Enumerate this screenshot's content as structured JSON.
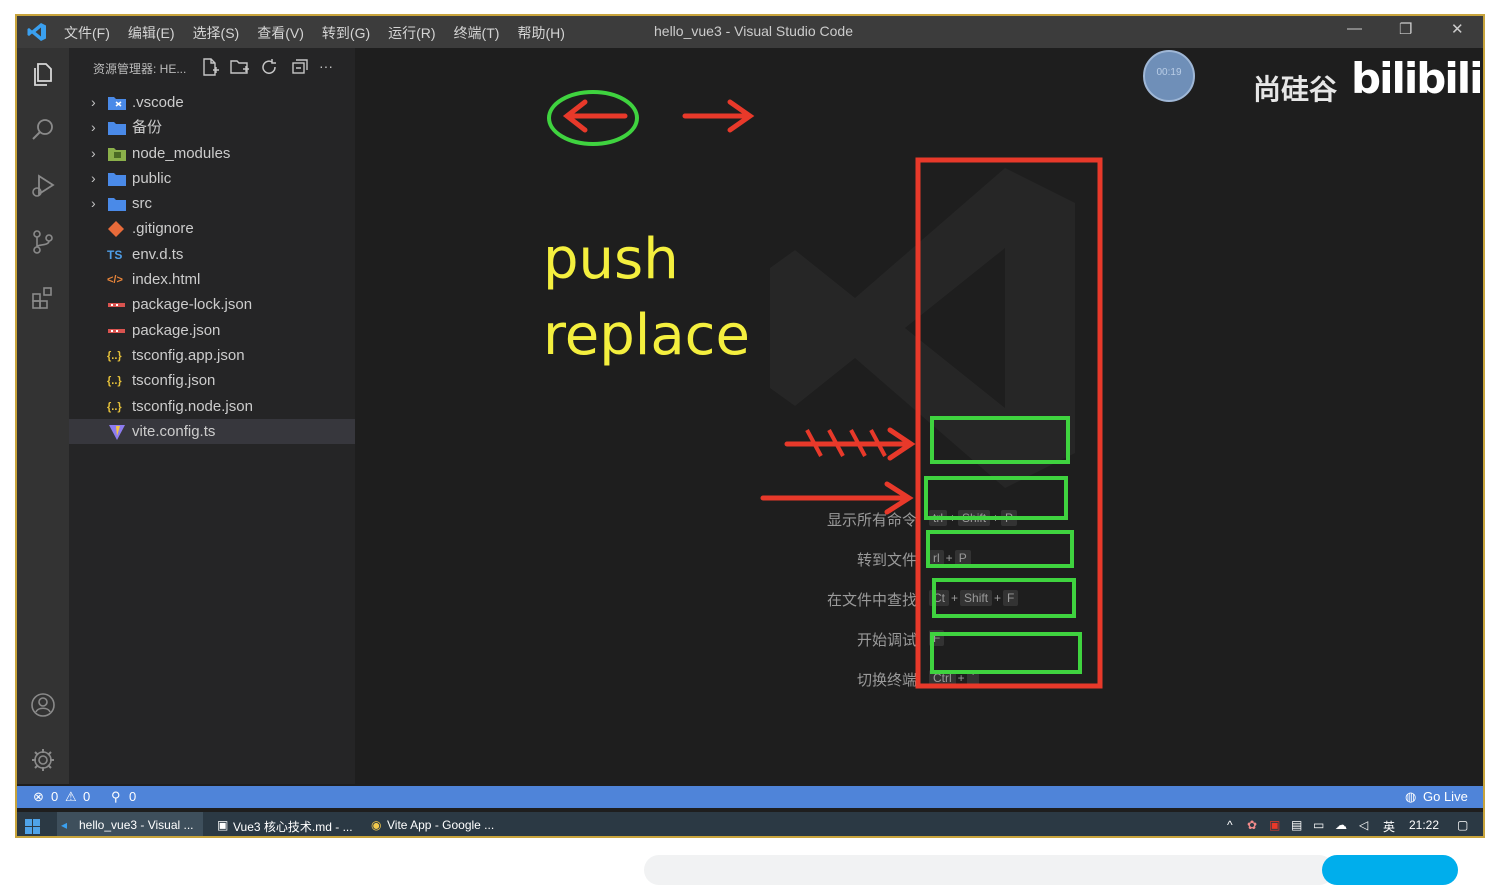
{
  "titlebar": {
    "menus": [
      "文件(F)",
      "编辑(E)",
      "选择(S)",
      "查看(V)",
      "转到(G)",
      "运行(R)",
      "终端(T)",
      "帮助(H)"
    ],
    "window_title": "hello_vue3 - Visual Studio Code",
    "minimize": "—",
    "restore": "❐",
    "close": "✕"
  },
  "overlay": {
    "timer": "00:19",
    "watermark_text": "尚硅谷",
    "watermark_logo": "bilibili"
  },
  "sidebar": {
    "header": "资源管理器: HE...",
    "more": "···",
    "items": [
      {
        "label": ".vscode",
        "type": "folder",
        "icon": "vscode-folder-icon"
      },
      {
        "label": "备份",
        "type": "folder",
        "icon": "folder-icon"
      },
      {
        "label": "node_modules",
        "type": "folder",
        "icon": "node-folder-icon"
      },
      {
        "label": "public",
        "type": "folder",
        "icon": "folder-icon"
      },
      {
        "label": "src",
        "type": "folder",
        "icon": "folder-icon"
      },
      {
        "label": ".gitignore",
        "type": "file",
        "icon": "git-icon"
      },
      {
        "label": "env.d.ts",
        "type": "file",
        "icon": "ts-icon",
        "icon_text": "TS"
      },
      {
        "label": "index.html",
        "type": "file",
        "icon": "html-icon",
        "icon_text": "</>"
      },
      {
        "label": "package-lock.json",
        "type": "file",
        "icon": "npm-icon"
      },
      {
        "label": "package.json",
        "type": "file",
        "icon": "npm-icon"
      },
      {
        "label": "tsconfig.app.json",
        "type": "file",
        "icon": "json-icon",
        "icon_text": "{..}"
      },
      {
        "label": "tsconfig.json",
        "type": "file",
        "icon": "json-icon",
        "icon_text": "{..}"
      },
      {
        "label": "tsconfig.node.json",
        "type": "file",
        "icon": "json-icon",
        "icon_text": "{..}"
      },
      {
        "label": "vite.config.ts",
        "type": "file",
        "icon": "vite-icon",
        "selected": true
      }
    ]
  },
  "editor": {
    "annotation_line1": "push",
    "annotation_line2": "replace",
    "shortcuts": [
      {
        "label": "显示所有命令",
        "keys": [
          "trl",
          "+",
          "Shift",
          "+",
          "P"
        ]
      },
      {
        "label": "转到文件",
        "keys": [
          "rl",
          "+",
          "P"
        ]
      },
      {
        "label": "在文件中查找",
        "keys": [
          "Ct",
          "+",
          "Shift",
          "+",
          "F"
        ]
      },
      {
        "label": "开始调试",
        "keys": [
          "F"
        ]
      },
      {
        "label": "切换终端",
        "keys": [
          "Ctrl",
          "+",
          "`"
        ]
      }
    ]
  },
  "statusbar": {
    "errors": "0",
    "warnings": "0",
    "ports": "0",
    "go_live": "Go Live"
  },
  "taskbar": {
    "tasks": [
      "hello_vue3 - Visual ...",
      "Vue3 核心技术.md - ...",
      "Vite App - Google ..."
    ],
    "ime": "英",
    "time": "21:22"
  },
  "colors": {
    "annotation_yellow": "#f4ef3e",
    "annotation_red": "#e8392a",
    "annotation_green": "#3fd33f",
    "statusbar": "#4f84d9"
  }
}
